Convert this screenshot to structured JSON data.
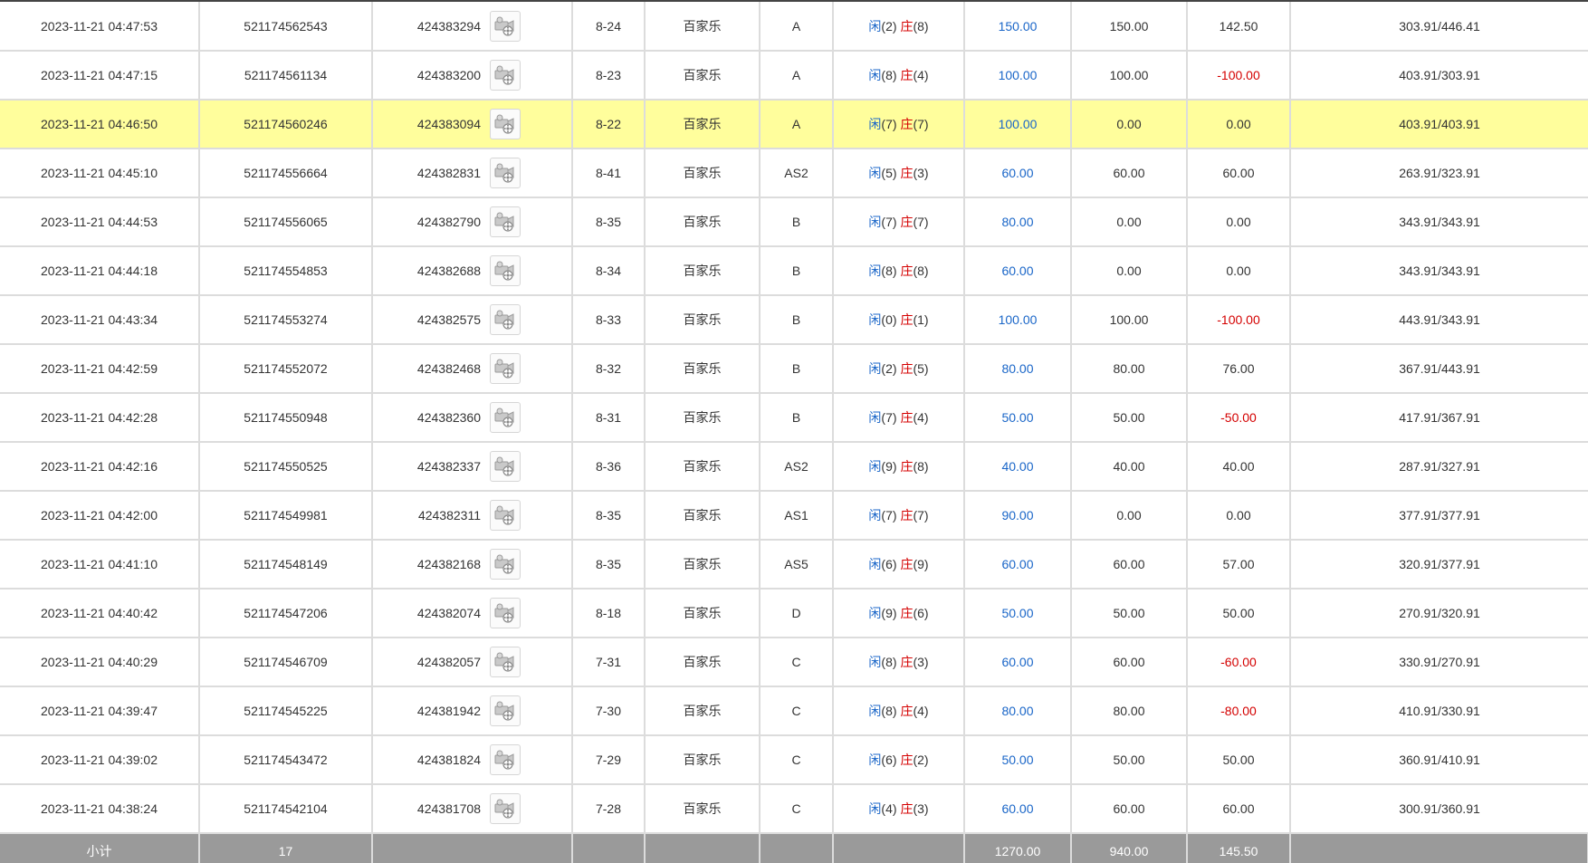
{
  "colors": {
    "highlight": "#fffe9c",
    "blue": "#1a66c8",
    "red": "#d40000",
    "total_bg": "#9a9a9a"
  },
  "icons": {
    "round_detail": "video-camera-icon"
  },
  "rows": [
    {
      "time": "2023-11-21 04:47:53",
      "order_no": "521174562543",
      "round_no": "424383294",
      "shoe": "8-24",
      "game": "百家乐",
      "table": "A",
      "p_label": "闲",
      "p_score": "(2)",
      "b_label": "庄",
      "b_score": "(8)",
      "bet": "150.00",
      "valid": "150.00",
      "win": "142.50",
      "win_neg": false,
      "balance": "303.91/446.41",
      "highlight": false
    },
    {
      "time": "2023-11-21 04:47:15",
      "order_no": "521174561134",
      "round_no": "424383200",
      "shoe": "8-23",
      "game": "百家乐",
      "table": "A",
      "p_label": "闲",
      "p_score": "(8)",
      "b_label": "庄",
      "b_score": "(4)",
      "bet": "100.00",
      "valid": "100.00",
      "win": "-100.00",
      "win_neg": true,
      "balance": "403.91/303.91",
      "highlight": false
    },
    {
      "time": "2023-11-21 04:46:50",
      "order_no": "521174560246",
      "round_no": "424383094",
      "shoe": "8-22",
      "game": "百家乐",
      "table": "A",
      "p_label": "闲",
      "p_score": "(7)",
      "b_label": "庄",
      "b_score": "(7)",
      "bet": "100.00",
      "valid": "0.00",
      "win": "0.00",
      "win_neg": false,
      "balance": "403.91/403.91",
      "highlight": true
    },
    {
      "time": "2023-11-21 04:45:10",
      "order_no": "521174556664",
      "round_no": "424382831",
      "shoe": "8-41",
      "game": "百家乐",
      "table": "AS2",
      "p_label": "闲",
      "p_score": "(5)",
      "b_label": "庄",
      "b_score": "(3)",
      "bet": "60.00",
      "valid": "60.00",
      "win": "60.00",
      "win_neg": false,
      "balance": "263.91/323.91",
      "highlight": false
    },
    {
      "time": "2023-11-21 04:44:53",
      "order_no": "521174556065",
      "round_no": "424382790",
      "shoe": "8-35",
      "game": "百家乐",
      "table": "B",
      "p_label": "闲",
      "p_score": "(7)",
      "b_label": "庄",
      "b_score": "(7)",
      "bet": "80.00",
      "valid": "0.00",
      "win": "0.00",
      "win_neg": false,
      "balance": "343.91/343.91",
      "highlight": false
    },
    {
      "time": "2023-11-21 04:44:18",
      "order_no": "521174554853",
      "round_no": "424382688",
      "shoe": "8-34",
      "game": "百家乐",
      "table": "B",
      "p_label": "闲",
      "p_score": "(8)",
      "b_label": "庄",
      "b_score": "(8)",
      "bet": "60.00",
      "valid": "0.00",
      "win": "0.00",
      "win_neg": false,
      "balance": "343.91/343.91",
      "highlight": false
    },
    {
      "time": "2023-11-21 04:43:34",
      "order_no": "521174553274",
      "round_no": "424382575",
      "shoe": "8-33",
      "game": "百家乐",
      "table": "B",
      "p_label": "闲",
      "p_score": "(0)",
      "b_label": "庄",
      "b_score": "(1)",
      "bet": "100.00",
      "valid": "100.00",
      "win": "-100.00",
      "win_neg": true,
      "balance": "443.91/343.91",
      "highlight": false
    },
    {
      "time": "2023-11-21 04:42:59",
      "order_no": "521174552072",
      "round_no": "424382468",
      "shoe": "8-32",
      "game": "百家乐",
      "table": "B",
      "p_label": "闲",
      "p_score": "(2)",
      "b_label": "庄",
      "b_score": "(5)",
      "bet": "80.00",
      "valid": "80.00",
      "win": "76.00",
      "win_neg": false,
      "balance": "367.91/443.91",
      "highlight": false
    },
    {
      "time": "2023-11-21 04:42:28",
      "order_no": "521174550948",
      "round_no": "424382360",
      "shoe": "8-31",
      "game": "百家乐",
      "table": "B",
      "p_label": "闲",
      "p_score": "(7)",
      "b_label": "庄",
      "b_score": "(4)",
      "bet": "50.00",
      "valid": "50.00",
      "win": "-50.00",
      "win_neg": true,
      "balance": "417.91/367.91",
      "highlight": false
    },
    {
      "time": "2023-11-21 04:42:16",
      "order_no": "521174550525",
      "round_no": "424382337",
      "shoe": "8-36",
      "game": "百家乐",
      "table": "AS2",
      "p_label": "闲",
      "p_score": "(9)",
      "b_label": "庄",
      "b_score": "(8)",
      "bet": "40.00",
      "valid": "40.00",
      "win": "40.00",
      "win_neg": false,
      "balance": "287.91/327.91",
      "highlight": false
    },
    {
      "time": "2023-11-21 04:42:00",
      "order_no": "521174549981",
      "round_no": "424382311",
      "shoe": "8-35",
      "game": "百家乐",
      "table": "AS1",
      "p_label": "闲",
      "p_score": "(7)",
      "b_label": "庄",
      "b_score": "(7)",
      "bet": "90.00",
      "valid": "0.00",
      "win": "0.00",
      "win_neg": false,
      "balance": "377.91/377.91",
      "highlight": false
    },
    {
      "time": "2023-11-21 04:41:10",
      "order_no": "521174548149",
      "round_no": "424382168",
      "shoe": "8-35",
      "game": "百家乐",
      "table": "AS5",
      "p_label": "闲",
      "p_score": "(6)",
      "b_label": "庄",
      "b_score": "(9)",
      "bet": "60.00",
      "valid": "60.00",
      "win": "57.00",
      "win_neg": false,
      "balance": "320.91/377.91",
      "highlight": false
    },
    {
      "time": "2023-11-21 04:40:42",
      "order_no": "521174547206",
      "round_no": "424382074",
      "shoe": "8-18",
      "game": "百家乐",
      "table": "D",
      "p_label": "闲",
      "p_score": "(9)",
      "b_label": "庄",
      "b_score": "(6)",
      "bet": "50.00",
      "valid": "50.00",
      "win": "50.00",
      "win_neg": false,
      "balance": "270.91/320.91",
      "highlight": false
    },
    {
      "time": "2023-11-21 04:40:29",
      "order_no": "521174546709",
      "round_no": "424382057",
      "shoe": "7-31",
      "game": "百家乐",
      "table": "C",
      "p_label": "闲",
      "p_score": "(8)",
      "b_label": "庄",
      "b_score": "(3)",
      "bet": "60.00",
      "valid": "60.00",
      "win": "-60.00",
      "win_neg": true,
      "balance": "330.91/270.91",
      "highlight": false
    },
    {
      "time": "2023-11-21 04:39:47",
      "order_no": "521174545225",
      "round_no": "424381942",
      "shoe": "7-30",
      "game": "百家乐",
      "table": "C",
      "p_label": "闲",
      "p_score": "(8)",
      "b_label": "庄",
      "b_score": "(4)",
      "bet": "80.00",
      "valid": "80.00",
      "win": "-80.00",
      "win_neg": true,
      "balance": "410.91/330.91",
      "highlight": false
    },
    {
      "time": "2023-11-21 04:39:02",
      "order_no": "521174543472",
      "round_no": "424381824",
      "shoe": "7-29",
      "game": "百家乐",
      "table": "C",
      "p_label": "闲",
      "p_score": "(6)",
      "b_label": "庄",
      "b_score": "(2)",
      "bet": "50.00",
      "valid": "50.00",
      "win": "50.00",
      "win_neg": false,
      "balance": "360.91/410.91",
      "highlight": false
    },
    {
      "time": "2023-11-21 04:38:24",
      "order_no": "521174542104",
      "round_no": "424381708",
      "shoe": "7-28",
      "game": "百家乐",
      "table": "C",
      "p_label": "闲",
      "p_score": "(4)",
      "b_label": "庄",
      "b_score": "(3)",
      "bet": "60.00",
      "valid": "60.00",
      "win": "60.00",
      "win_neg": false,
      "balance": "300.91/360.91",
      "highlight": false
    }
  ],
  "total": {
    "label": "小计",
    "count": "17",
    "bet": "1270.00",
    "valid": "940.00",
    "win": "145.50"
  }
}
